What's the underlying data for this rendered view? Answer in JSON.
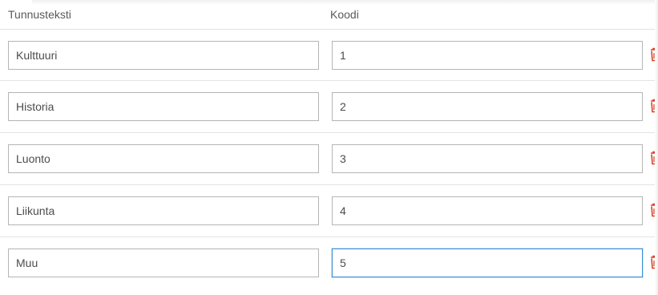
{
  "header": {
    "label_column": "Tunnusteksti",
    "code_column": "Koodi"
  },
  "rows": [
    {
      "label": "Kulttuuri",
      "code": "1"
    },
    {
      "label": "Historia",
      "code": "2"
    },
    {
      "label": "Luonto",
      "code": "3"
    },
    {
      "label": "Liikunta",
      "code": "4"
    },
    {
      "label": "Muu",
      "code": "5"
    }
  ],
  "icons": {
    "delete": "trash-icon"
  },
  "colors": {
    "delete_icon": "#d6432a",
    "focus_border": "#3b8fd6"
  }
}
